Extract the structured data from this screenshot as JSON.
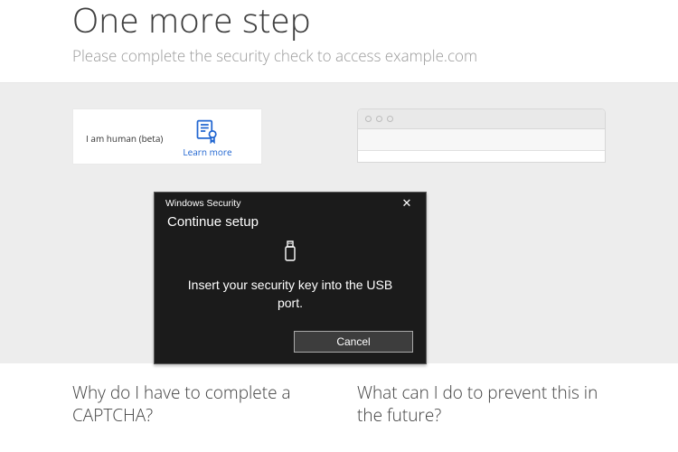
{
  "header": {
    "title": "One more step",
    "subtitle": "Please complete the security check to access example.com"
  },
  "captcha": {
    "label": "I am human (beta)",
    "learn_more": "Learn more"
  },
  "dialog": {
    "window_title": "Windows Security",
    "heading": "Continue setup",
    "message": "Insert your security key into the USB port.",
    "cancel": "Cancel"
  },
  "questions": {
    "left": "Why do I have to complete a CAPTCHA?",
    "right": "What can I do to prevent this in the future?"
  }
}
